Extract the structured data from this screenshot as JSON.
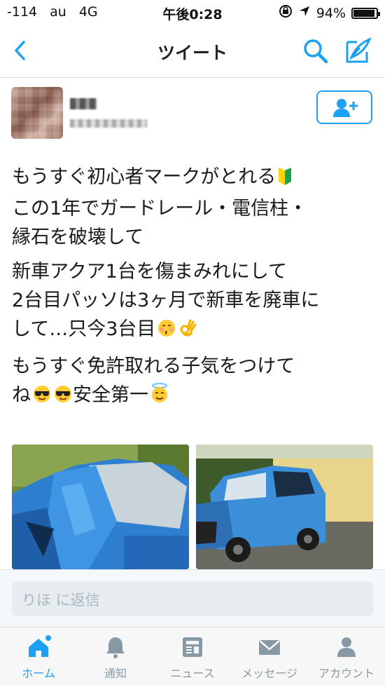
{
  "status_bar": {
    "signal": "-114",
    "carrier": "au",
    "network": "4G",
    "time": "午後0:28",
    "battery_percent": "94%",
    "battery_level": 0.94
  },
  "nav": {
    "title": "ツイート",
    "back_icon": "chevron-left-icon",
    "search_icon": "search-icon",
    "compose_icon": "compose-icon"
  },
  "tweet": {
    "lines": [
      "もうすぐ初心者マークがとれる",
      "この1年でガードレール・電信柱・",
      "縁石を破壊して",
      "新車アクア1台を傷まみれにして",
      "2台目パッソは3ヶ月で新車を廃車に",
      "して…只今3台目",
      "もうすぐ免許取れる子気をつけて",
      "ね",
      "安全第一"
    ],
    "images": [
      "wrecked-car-front",
      "wrecked-blue-car"
    ]
  },
  "reply": {
    "placeholder": "りほ に返信"
  },
  "tabs": [
    {
      "label": "ホーム",
      "icon": "home-icon",
      "active": true
    },
    {
      "label": "通知",
      "icon": "bell-icon",
      "active": false
    },
    {
      "label": "ニュース",
      "icon": "news-icon",
      "active": false
    },
    {
      "label": "メッセージ",
      "icon": "envelope-icon",
      "active": false
    },
    {
      "label": "アカウント",
      "icon": "person-icon",
      "active": false
    }
  ],
  "colors": {
    "accent": "#1da1f2",
    "tab_inactive": "#8899a6"
  }
}
